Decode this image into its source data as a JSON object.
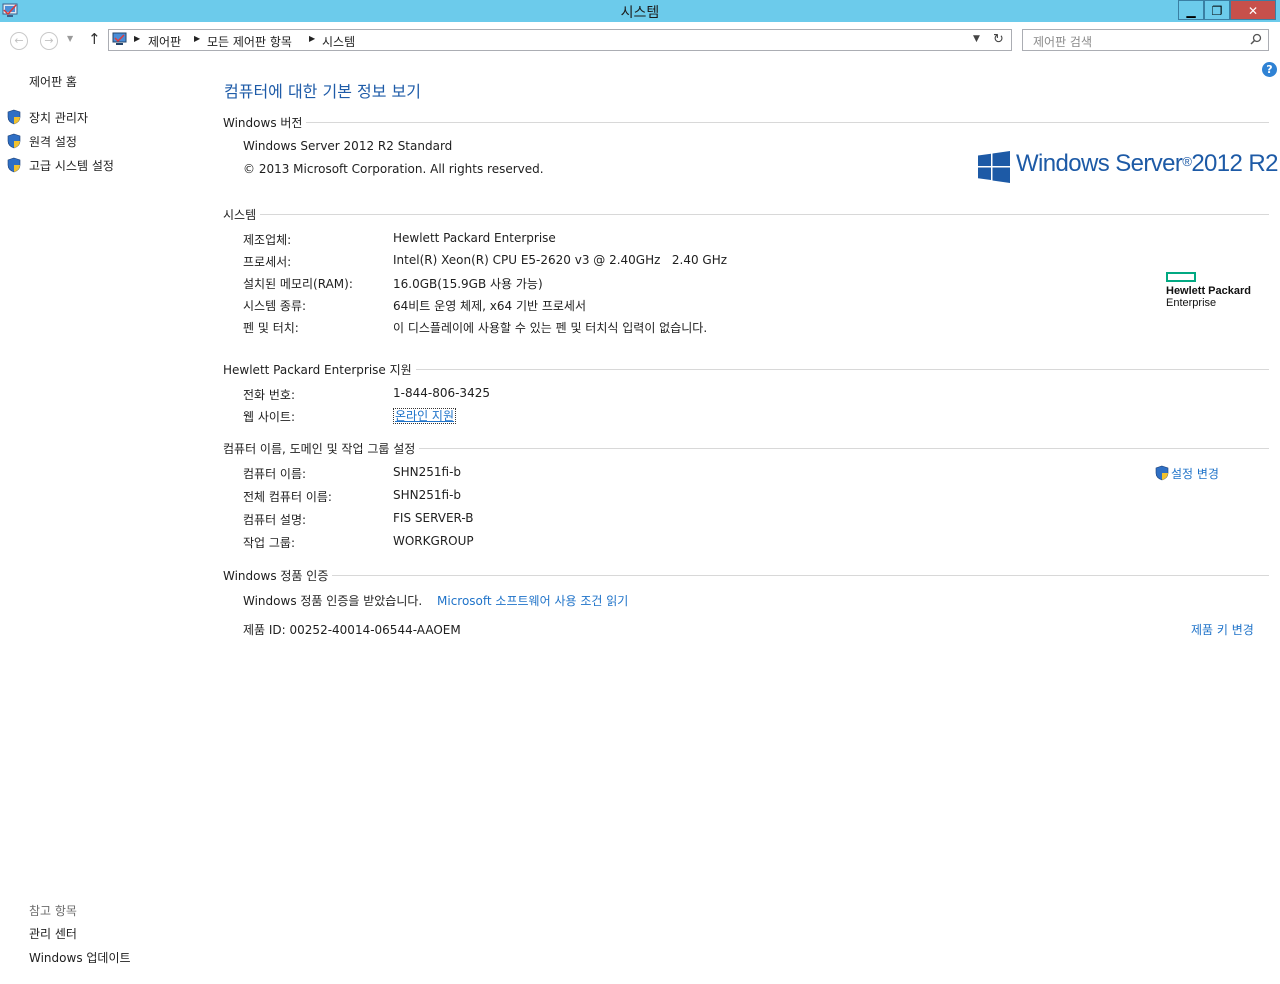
{
  "window": {
    "title": "시스템",
    "minimize": "▁",
    "maximize": "❐",
    "close": "✕"
  },
  "navigation": {
    "back_icon": "back-arrow-icon",
    "forward_icon": "forward-arrow-icon",
    "up_icon": "up-arrow-icon",
    "breadcrumb": [
      "제어판",
      "모든 제어판 항목",
      "시스템"
    ],
    "search_placeholder": "제어판 검색"
  },
  "sidebar": {
    "home": "제어판 홈",
    "links": [
      "장치 관리자",
      "원격 설정",
      "고급 시스템 설정"
    ],
    "see_also_header": "참고 항목",
    "see_also": [
      "관리 센터",
      "Windows 업데이트"
    ]
  },
  "main": {
    "title": "컴퓨터에 대한 기본 정보 보기",
    "windows_edition": {
      "header": "Windows 버전",
      "edition": "Windows Server 2012 R2 Standard",
      "copyright": "© 2013 Microsoft Corporation. All rights reserved.",
      "logo_text": "Windows Server",
      "logo_sup": "®",
      "logo_version": "2012 R2"
    },
    "system": {
      "header": "시스템",
      "rows": [
        {
          "label": "제조업체:",
          "value": "Hewlett Packard Enterprise"
        },
        {
          "label": "프로세서:",
          "value": "Intel(R) Xeon(R) CPU E5-2620 v3 @ 2.40GHz   2.40 GHz"
        },
        {
          "label": "설치된 메모리(RAM):",
          "value": "16.0GB(15.9GB 사용 가능)"
        },
        {
          "label": "시스템 종류:",
          "value": "64비트 운영 체제, x64 기반 프로세서"
        },
        {
          "label": "펜 및 터치:",
          "value": "이 디스플레이에 사용할 수 있는 펜 및 터치식 입력이 없습니다."
        }
      ],
      "oem_logo_line1": "Hewlett Packard",
      "oem_logo_line2": "Enterprise"
    },
    "support": {
      "header": "Hewlett Packard Enterprise 지원",
      "phone_label": "전화 번호:",
      "phone_value": "1-844-806-3425",
      "website_label": "웹 사이트:",
      "website_value": "온라인 지원"
    },
    "computer_name": {
      "header": "컴퓨터 이름, 도메인 및 작업 그룹 설정",
      "rows": [
        {
          "label": "컴퓨터 이름:",
          "value": "SHN251fi-b"
        },
        {
          "label": "전체 컴퓨터 이름:",
          "value": "SHN251fi-b"
        },
        {
          "label": "컴퓨터 설명:",
          "value": "FIS SERVER-B"
        },
        {
          "label": "작업 그룹:",
          "value": "WORKGROUP"
        }
      ],
      "change_settings": "설정 변경"
    },
    "activation": {
      "header": "Windows 정품 인증",
      "status": "Windows 정품 인증을 받았습니다.",
      "license_link": "Microsoft 소프트웨어 사용 조건 읽기",
      "product_id": "제품 ID: 00252-40014-06544-AAOEM",
      "change_key": "제품 키 변경"
    }
  },
  "colors": {
    "titlebar": "#6ccbeb",
    "link": "#1f73c9",
    "title": "#1e5ba8",
    "hpe_green": "#01a982"
  }
}
